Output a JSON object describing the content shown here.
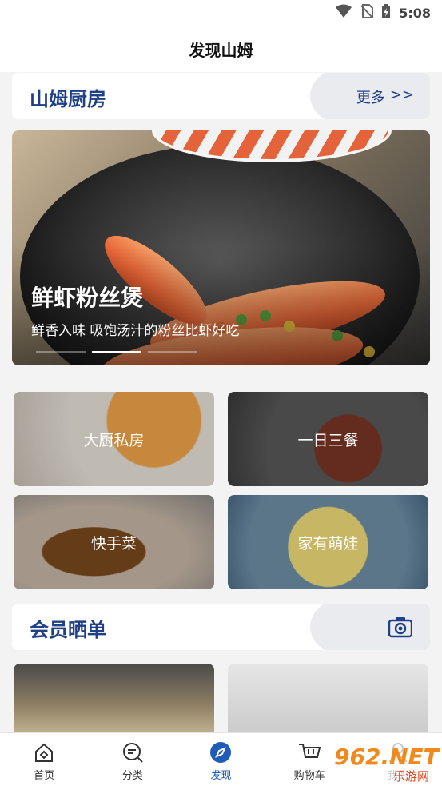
{
  "status_bar": {
    "time": "5:08",
    "icons": [
      "wifi-icon",
      "no-sim-icon",
      "battery-charging-icon"
    ]
  },
  "header": {
    "title": "发现山姆"
  },
  "kitchen": {
    "title": "山姆厨房",
    "more_label": "更多",
    "more_arrow": ">>"
  },
  "hero": {
    "title": "鲜虾粉丝煲",
    "subtitle": "鲜香入味 吸饱汤汁的粉丝比虾好吃",
    "slide_count": 3,
    "active_slide": 2
  },
  "categories": [
    {
      "label": "大厨私房"
    },
    {
      "label": "一日三餐"
    },
    {
      "label": "快手菜"
    },
    {
      "label": "家有萌娃"
    }
  ],
  "member": {
    "title": "会员晒单",
    "camera_icon": "camera-icon"
  },
  "bottom_nav": [
    {
      "label": "首页",
      "icon": "home-icon"
    },
    {
      "label": "分类",
      "icon": "category-search-icon"
    },
    {
      "label": "发现",
      "icon": "compass-icon",
      "active": true
    },
    {
      "label": "购物车",
      "icon": "cart-icon"
    },
    {
      "label": "我的",
      "icon": "user-icon"
    }
  ],
  "watermark": {
    "text": "962.NET",
    "sub": "乐游网"
  },
  "colors": {
    "accent": "#1f3f86",
    "nav_active": "#1f5cb8",
    "watermark_orange": "#f08a1c"
  }
}
